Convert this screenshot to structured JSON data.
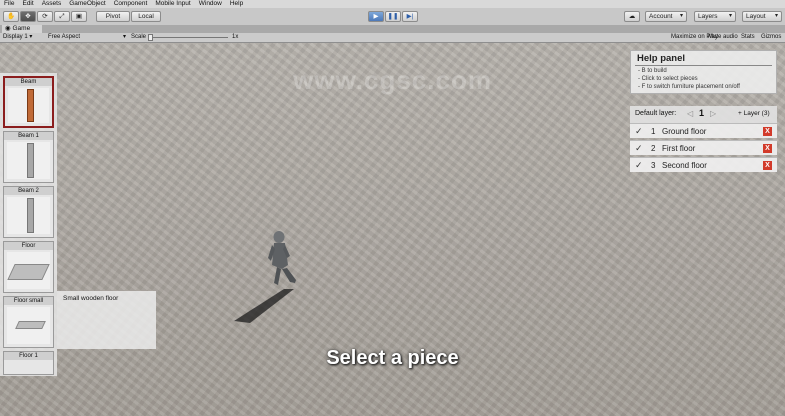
{
  "menu": [
    "File",
    "Edit",
    "Assets",
    "GameObject",
    "Component",
    "Mobile Input",
    "Window",
    "Help"
  ],
  "toolbar": {
    "pivot": "Pivot",
    "local": "Local",
    "account": "Account",
    "layers": "Layers",
    "layout": "Layout"
  },
  "game_tab": {
    "label": "Game",
    "display": "Display 1",
    "aspect": "Free Aspect",
    "scale_label": "Scale",
    "scale_value": "1x",
    "maximize": "Maximize on Play",
    "mute": "Mute audio",
    "stats": "Stats",
    "gizmos": "Gizmos"
  },
  "pieces": [
    {
      "label": "Beam"
    },
    {
      "label": "Beam 1"
    },
    {
      "label": "Beam 2"
    },
    {
      "label": "Floor"
    },
    {
      "label": "Floor small"
    },
    {
      "label": "Floor 1"
    }
  ],
  "tooltip": "Small wooden floor",
  "help": {
    "title": "Help panel",
    "lines": [
      "- B to build",
      "- Click to select pieces",
      "- F to switch furniture placement on/off"
    ]
  },
  "layers": {
    "default_label": "Default layer:",
    "current": "1",
    "add_label": "+ Layer (3)",
    "rows": [
      {
        "num": "1",
        "name": "Ground floor"
      },
      {
        "num": "2",
        "name": "First floor"
      },
      {
        "num": "3",
        "name": "Second floor"
      }
    ]
  },
  "subtitle": "Select a piece",
  "watermark": "www.cgsc.com",
  "colors": {
    "selected_border": "#8b1d1d",
    "delete_button": "#d23a2a",
    "play_button": "#4d79b8"
  }
}
